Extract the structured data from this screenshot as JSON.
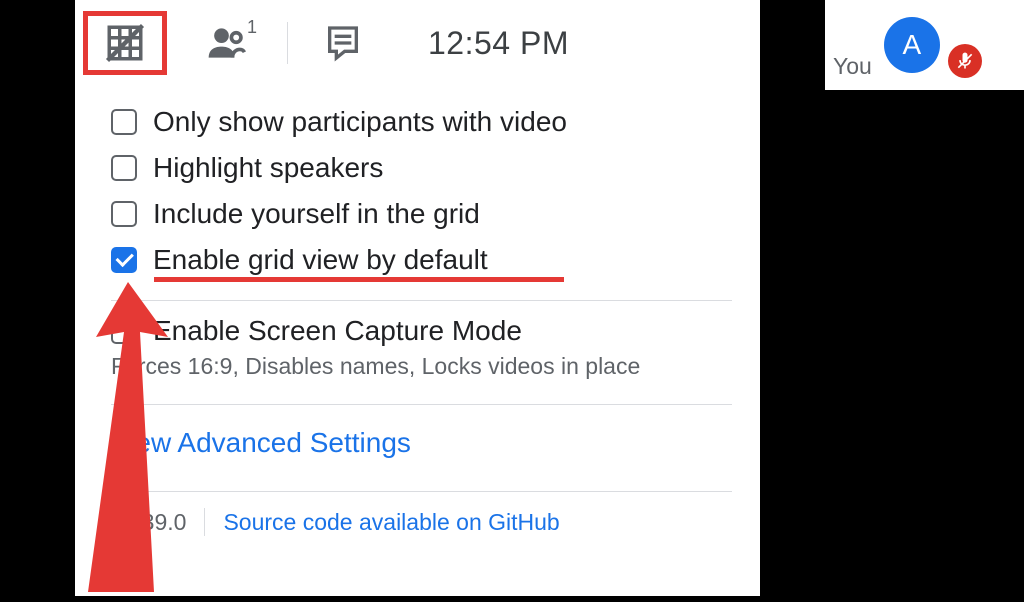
{
  "topbar": {
    "time": "12:54 PM",
    "participant_count": "1"
  },
  "options": [
    {
      "label": "Only show participants with video",
      "checked": false
    },
    {
      "label": "Highlight speakers",
      "checked": false
    },
    {
      "label": "Include yourself in the grid",
      "checked": false
    },
    {
      "label": "Enable grid view by default",
      "checked": true,
      "highlighted": true
    }
  ],
  "screen_capture": {
    "label": "Enable Screen Capture Mode",
    "desc": "Forces 16:9, Disables names, Locks videos in place"
  },
  "advanced_link": "View Advanced Settings",
  "footer": {
    "version": "v1.39.0",
    "source_link": "Source code available on GitHub"
  },
  "user": {
    "you_label": "You",
    "avatar_letter": "A"
  }
}
